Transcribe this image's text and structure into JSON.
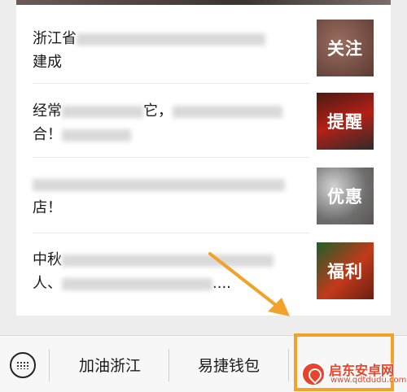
{
  "articles": [
    {
      "line1": "浙江省",
      "line2": "建成",
      "thumb": "关注"
    },
    {
      "line1": "经常",
      "line1b": "它，",
      "line2": "合！",
      "thumb": "提醒"
    },
    {
      "line1": "",
      "line2": "店！",
      "thumb": "优惠"
    },
    {
      "line1": "中秋",
      "line2": "人、",
      "line2b": "....",
      "thumb": "福利"
    }
  ],
  "menu": {
    "item1": "加油浙江",
    "item2": "易捷钱包"
  },
  "watermark": {
    "name": "启东安卓网",
    "url": "www.qdtdudu.com"
  },
  "colors": {
    "highlight": "#f3a229",
    "watermark": "#e8442b"
  }
}
